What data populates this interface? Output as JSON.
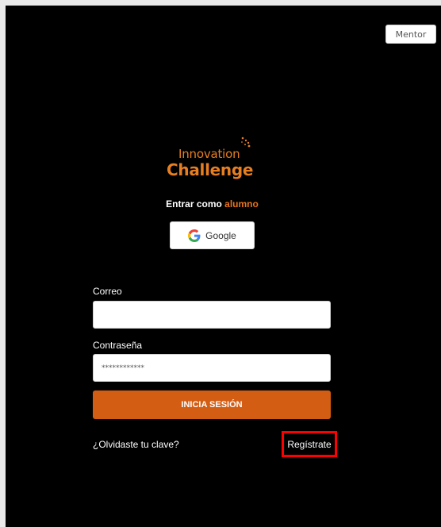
{
  "header": {
    "mentor_label": "Mentor"
  },
  "logo": {
    "line1": "Innovation",
    "line2": "Challenge"
  },
  "login": {
    "enter_prefix": "Entrar como ",
    "enter_role": "alumno",
    "google_label": "Google"
  },
  "form": {
    "email_label": "Correo",
    "email_value": "",
    "password_label": "Contraseña",
    "password_value": "************",
    "submit_label": "INICIA SESIÓN",
    "forgot_label": "¿Olvidaste tu clave?",
    "register_label": "Regístrate"
  },
  "colors": {
    "accent": "#e8731c",
    "button": "#d35d13",
    "background": "#000000",
    "highlight": "#ff0000"
  }
}
